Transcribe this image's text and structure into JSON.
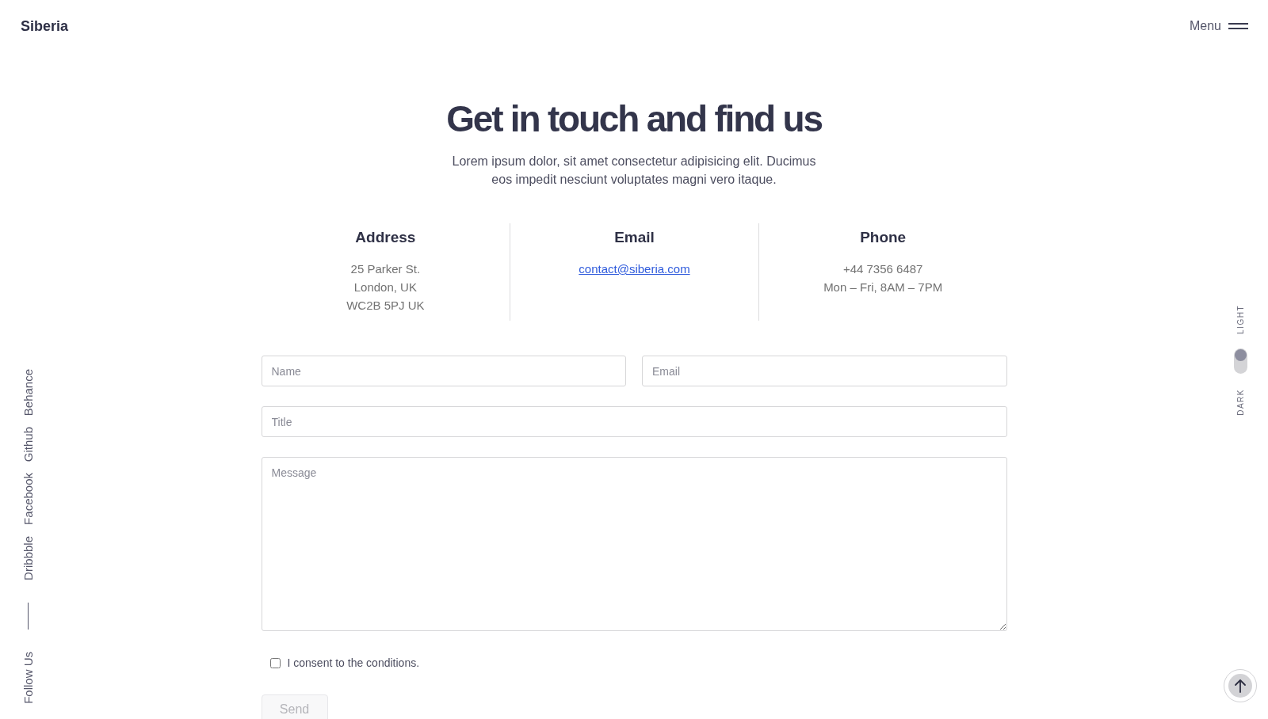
{
  "header": {
    "logo": "Siberia",
    "menu_label": "Menu"
  },
  "hero": {
    "title": "Get in touch and find us",
    "subtitle": "Lorem ipsum dolor, sit amet consectetur adipisicing elit. Ducimus eos impedit nesciunt voluptates magni vero itaque."
  },
  "contact_columns": [
    {
      "heading": "Address",
      "kind": "text",
      "lines": [
        "25 Parker St.",
        "London, UK",
        "WC2B 5PJ UK"
      ]
    },
    {
      "heading": "Email",
      "kind": "link",
      "lines": [
        "contact@siberia.com"
      ]
    },
    {
      "heading": "Phone",
      "kind": "text",
      "lines": [
        "+44 7356 6487",
        "Mon – Fri, 8AM – 7PM"
      ]
    }
  ],
  "form": {
    "rows": [
      {
        "fields": [
          {
            "kind": "input",
            "placeholder": "Name"
          },
          {
            "kind": "input",
            "placeholder": "Email"
          }
        ]
      },
      {
        "fields": [
          {
            "kind": "input",
            "placeholder": "Title"
          }
        ]
      },
      {
        "fields": [
          {
            "kind": "textarea",
            "placeholder": "Message"
          }
        ]
      }
    ],
    "consent": {
      "label": "I consent to the conditions.",
      "checked": false
    },
    "submit": {
      "label": "Send",
      "disabled": true
    }
  },
  "social_sidebar": {
    "label": "Follow Us",
    "links": [
      "Dribbble",
      "Facebook",
      "Github",
      "Behance"
    ]
  },
  "theme_switch": {
    "light_label": "LIGHT",
    "dark_label": "DARK",
    "dark_mode": false
  }
}
